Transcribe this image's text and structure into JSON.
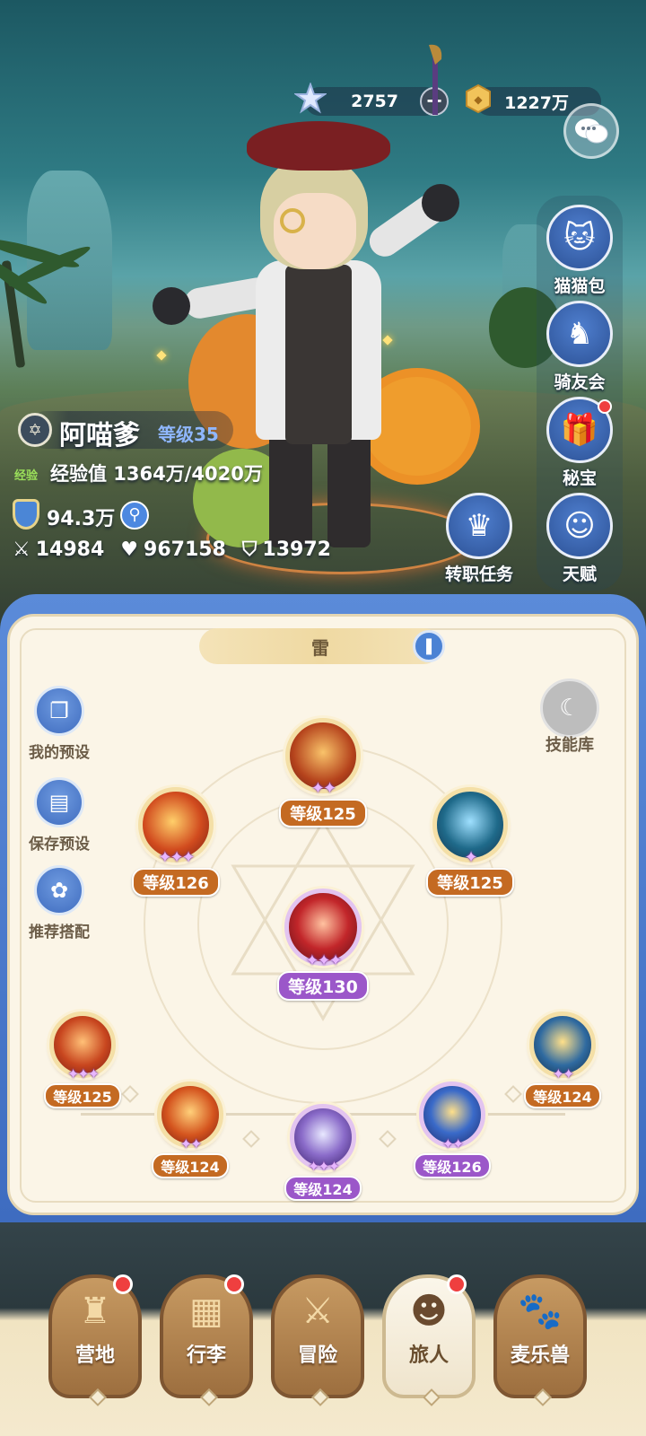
{
  "currency": {
    "gems": "2757",
    "plus": "+",
    "coins": "1227万"
  },
  "right_menu": [
    {
      "label": "猫猫包",
      "icon": "cat-bag-icon",
      "badge": false
    },
    {
      "label": "骑友会",
      "icon": "horse-icon",
      "badge": false
    },
    {
      "label": "秘宝",
      "icon": "treasure-icon",
      "badge": true
    },
    {
      "label": "天赋",
      "icon": "brain-icon",
      "badge": false
    }
  ],
  "job_quest": {
    "label": "转职任务"
  },
  "player": {
    "name": "阿喵爹",
    "level": "等级35",
    "exp_tag": "经验",
    "exp": "经验值 1364万/4020万",
    "power": "94.3万",
    "attack": "14984",
    "hp": "967158",
    "defense": "13972"
  },
  "element": {
    "name": "雷"
  },
  "left_actions": [
    {
      "label": "我的预设"
    },
    {
      "label": "保存预设"
    },
    {
      "label": "推荐搭配"
    }
  ],
  "skill_library": {
    "label": "技能库"
  },
  "skills": [
    {
      "level": "等级125",
      "stars": 2,
      "tier": "orange"
    },
    {
      "level": "等级126",
      "stars": 3,
      "tier": "orange"
    },
    {
      "level": "等级125",
      "stars": 1,
      "tier": "orange"
    },
    {
      "level": "等级130",
      "stars": 3,
      "tier": "purple"
    },
    {
      "level": "等级125",
      "stars": 3,
      "tier": "orange"
    },
    {
      "level": "等级124",
      "stars": 2,
      "tier": "orange"
    },
    {
      "level": "等级124",
      "stars": 3,
      "tier": "purple"
    },
    {
      "level": "等级126",
      "stars": 2,
      "tier": "purple"
    },
    {
      "level": "等级124",
      "stars": 2,
      "tier": "orange"
    }
  ],
  "nav": [
    {
      "label": "营地",
      "icon": "castle-icon",
      "badge": true,
      "active": false
    },
    {
      "label": "行李",
      "icon": "chest-icon",
      "badge": true,
      "active": false
    },
    {
      "label": "冒险",
      "icon": "swords-icon",
      "badge": false,
      "active": false
    },
    {
      "label": "旅人",
      "icon": "traveler-icon",
      "badge": true,
      "active": true
    },
    {
      "label": "麦乐兽",
      "icon": "beast-icon",
      "badge": false,
      "active": false
    }
  ],
  "colors": {
    "accent_blue": "#3e6cc0",
    "panel_bg": "#fbf5e7",
    "level_orange": "#c46a22",
    "level_purple": "#9b57c9",
    "badge_red": "#ef3f3f"
  }
}
